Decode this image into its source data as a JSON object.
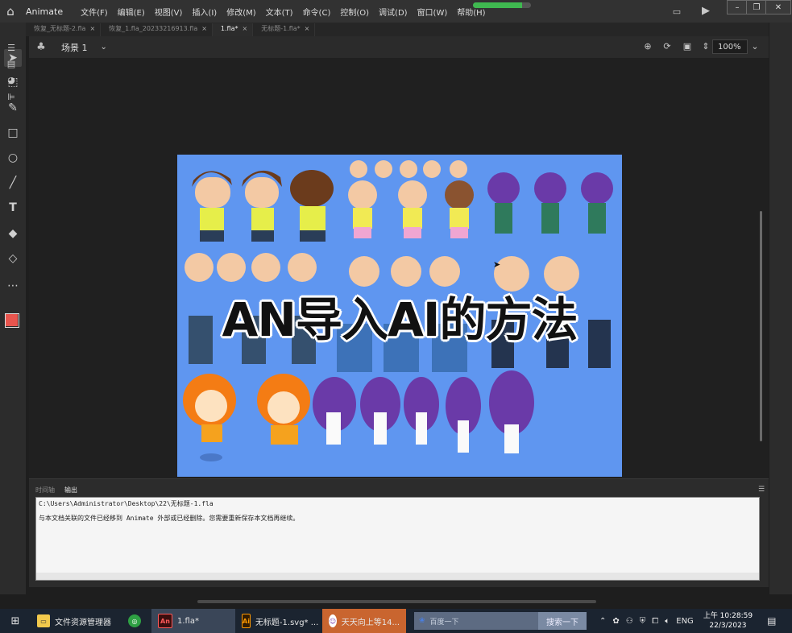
{
  "app": {
    "name": "Animate"
  },
  "menu": [
    "文件(F)",
    "编辑(E)",
    "视图(V)",
    "插入(I)",
    "修改(M)",
    "文本(T)",
    "命令(C)",
    "控制(O)",
    "调试(D)",
    "窗口(W)",
    "帮助(H)"
  ],
  "progress": 0.85,
  "tabs": [
    {
      "label": "恢复_无标题-2.fla",
      "active": false
    },
    {
      "label": "恢复_1.fla_20233216913.fla",
      "active": false
    },
    {
      "label": "1.fla*",
      "active": true
    },
    {
      "label": "无标题-1.fla*",
      "active": false
    }
  ],
  "tab_close_glyph": "×",
  "scene": {
    "label": "场景 1"
  },
  "zoom": "100%",
  "overlay_title": "AN导入AI的方法",
  "output": {
    "tabs": [
      "时间轴",
      "输出"
    ],
    "lines": [
      "C:\\Users\\Administrator\\Desktop\\22\\无标题-1.fla",
      "与本文档关联的文件已经移到 Animate 外部或已经删除。您需要重新保存本文档再继续。"
    ]
  },
  "taskbar": {
    "items": [
      {
        "label": "文件资源管理器",
        "icon": "folder-icon"
      },
      {
        "label": "",
        "icon": "360-icon"
      },
      {
        "label": "1.fla*",
        "icon": "animate-app-icon",
        "badge": "An"
      },
      {
        "label": "无标题-1.svg* ...",
        "icon": "illustrator-app-icon",
        "badge": "Ai"
      },
      {
        "label": "天天向上等14...",
        "icon": "browser-tab-icon"
      }
    ],
    "search_placeholder": "百度一下",
    "search_button": "搜索一下",
    "lang": "ENG",
    "time": "上午 10:28:59",
    "date": "22/3/2023"
  },
  "colors": {
    "stage_bg": "#5f96f0",
    "fill_swatch": "#e8554e",
    "accent": "#3fb950"
  }
}
